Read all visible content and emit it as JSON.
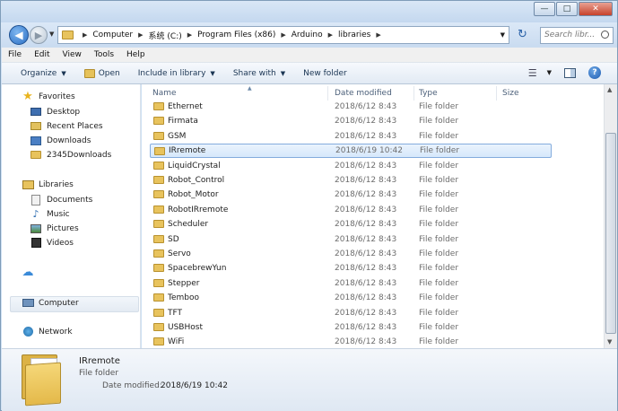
{
  "window": {
    "minimize": "—",
    "maximize": "□",
    "close": "✕"
  },
  "address": {
    "crumbs": [
      "Computer",
      "系统 (C:)",
      "Program Files (x86)",
      "Arduino",
      "libraries"
    ],
    "search_placeholder": "Search libr..."
  },
  "menu": [
    "File",
    "Edit",
    "View",
    "Tools",
    "Help"
  ],
  "toolbar": {
    "organize": "Organize",
    "open": "Open",
    "include": "Include in library",
    "share": "Share with",
    "new_folder": "New folder"
  },
  "nav": {
    "favorites": "Favorites",
    "desktop": "Desktop",
    "recent": "Recent Places",
    "downloads": "Downloads",
    "downloads2345": "2345Downloads",
    "libraries": "Libraries",
    "documents": "Documents",
    "music": "Music",
    "pictures": "Pictures",
    "videos": "Videos",
    "computer": "Computer",
    "network": "Network"
  },
  "columns": {
    "name": "Name",
    "date": "Date modified",
    "type": "Type",
    "size": "Size"
  },
  "files": [
    {
      "name": "Ethernet",
      "date": "2018/6/12 8:43",
      "type": "File folder"
    },
    {
      "name": "Firmata",
      "date": "2018/6/12 8:43",
      "type": "File folder"
    },
    {
      "name": "GSM",
      "date": "2018/6/12 8:43",
      "type": "File folder"
    },
    {
      "name": "IRremote",
      "date": "2018/6/19 10:42",
      "type": "File folder"
    },
    {
      "name": "LiquidCrystal",
      "date": "2018/6/12 8:43",
      "type": "File folder"
    },
    {
      "name": "Robot_Control",
      "date": "2018/6/12 8:43",
      "type": "File folder"
    },
    {
      "name": "Robot_Motor",
      "date": "2018/6/12 8:43",
      "type": "File folder"
    },
    {
      "name": "RobotIRremote",
      "date": "2018/6/12 8:43",
      "type": "File folder"
    },
    {
      "name": "Scheduler",
      "date": "2018/6/12 8:43",
      "type": "File folder"
    },
    {
      "name": "SD",
      "date": "2018/6/12 8:43",
      "type": "File folder"
    },
    {
      "name": "Servo",
      "date": "2018/6/12 8:43",
      "type": "File folder"
    },
    {
      "name": "SpacebrewYun",
      "date": "2018/6/12 8:43",
      "type": "File folder"
    },
    {
      "name": "Stepper",
      "date": "2018/6/12 8:43",
      "type": "File folder"
    },
    {
      "name": "Temboo",
      "date": "2018/6/12 8:43",
      "type": "File folder"
    },
    {
      "name": "TFT",
      "date": "2018/6/12 8:43",
      "type": "File folder"
    },
    {
      "name": "USBHost",
      "date": "2018/6/12 8:43",
      "type": "File folder"
    },
    {
      "name": "WiFi",
      "date": "2018/6/12 8:43",
      "type": "File folder"
    }
  ],
  "selected_index": 3,
  "details": {
    "name": "IRremote",
    "type": "File folder",
    "modified_label": "Date modified:",
    "modified_value": "2018/6/19 10:42"
  }
}
